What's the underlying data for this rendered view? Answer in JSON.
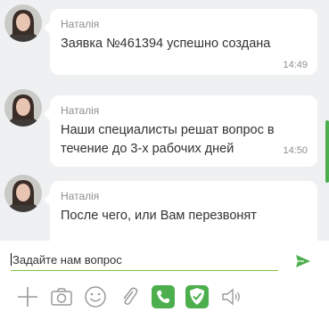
{
  "messages": [
    {
      "sender": "Наталія",
      "lines": [
        "Заявка №461394 успешно создана"
      ],
      "time": "14:49"
    },
    {
      "sender": "Наталія",
      "lines": [
        "Наши специалисты решат вопрос в",
        "течение до 3-х рабочих дней"
      ],
      "time": "14:50"
    },
    {
      "sender": "Наталія",
      "lines": [
        "После чего, или Вам перезвонят"
      ],
      "time": ""
    }
  ],
  "composer": {
    "placeholder": "Задайте нам вопрос",
    "send_icon": "send-icon"
  },
  "toolbar": {
    "icons": [
      "plus-icon",
      "camera-icon",
      "smile-icon",
      "paperclip-icon",
      "phone-icon",
      "shield-check-icon",
      "speaker-icon"
    ]
  },
  "colors": {
    "accent": "#4cae4c",
    "chat_bg": "#eef0f2",
    "input_underline": "#7cc242"
  }
}
